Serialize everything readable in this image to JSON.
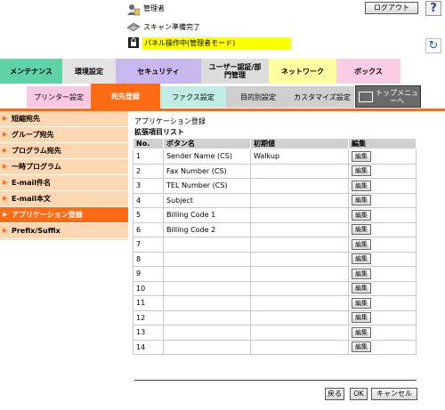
{
  "header": {
    "user_label": "管理者",
    "logout_label": "ログアウト",
    "help_glyph": "?",
    "scan_status": "スキャン準備完了",
    "panel_status": "パネル操作中(管理者モード)",
    "refresh_glyph": "↻"
  },
  "main_tabs": [
    {
      "label": "メンテナンス",
      "color": "#5fd3a8"
    },
    {
      "label": "環境設定",
      "color": "#e3e3e3"
    },
    {
      "label": "セキュリティ",
      "color": "#c9b7f0"
    },
    {
      "label": "ユーザー認証/部門管理",
      "color": "#dcdcdc"
    },
    {
      "label": "ネットワーク",
      "color": "#ffffa0"
    },
    {
      "label": "ボックス",
      "color": "#fbcde4"
    }
  ],
  "sub_tabs": [
    {
      "label": "プリンター設定",
      "color": "#fbc8e4"
    },
    {
      "label": "宛先登録",
      "color": "#ff6a13",
      "active": true
    },
    {
      "label": "ファクス設定",
      "color": "#c0ece6"
    },
    {
      "label": "目的別設定",
      "color": "#cfcfcf"
    },
    {
      "label": "カスタマイズ設定",
      "color": "#cfcfcf"
    }
  ],
  "top_menu_label": "トップメニューへ",
  "sidebar": {
    "items": [
      {
        "label": "短縮宛先"
      },
      {
        "label": "グループ宛先"
      },
      {
        "label": "プログラム宛先"
      },
      {
        "label": "一時プログラム"
      },
      {
        "label": "E-mail件名"
      },
      {
        "label": "E-mail本文"
      },
      {
        "label": "アプリケーション登録",
        "active": true
      },
      {
        "label": "Prefix/Suffix"
      }
    ]
  },
  "content": {
    "title": "アプリケーション登録",
    "subtitle": "拡張項目リスト",
    "columns": [
      "No.",
      "ボタン名",
      "初期値",
      "編集"
    ],
    "edit_label": "編集",
    "rows": [
      {
        "no": "1",
        "name": "Sender Name (CS)",
        "initial": "Walkup"
      },
      {
        "no": "2",
        "name": "Fax Number (CS)",
        "initial": ""
      },
      {
        "no": "3",
        "name": "TEL Number (CS)",
        "initial": ""
      },
      {
        "no": "4",
        "name": "Subject",
        "initial": ""
      },
      {
        "no": "5",
        "name": "Billing Code 1",
        "initial": ""
      },
      {
        "no": "6",
        "name": "Billing Code 2",
        "initial": ""
      },
      {
        "no": "7",
        "name": "",
        "initial": ""
      },
      {
        "no": "8",
        "name": "",
        "initial": ""
      },
      {
        "no": "9",
        "name": "",
        "initial": ""
      },
      {
        "no": "10",
        "name": "",
        "initial": ""
      },
      {
        "no": "11",
        "name": "",
        "initial": ""
      },
      {
        "no": "12",
        "name": "",
        "initial": ""
      },
      {
        "no": "13",
        "name": "",
        "initial": ""
      },
      {
        "no": "14",
        "name": "",
        "initial": ""
      }
    ]
  },
  "footer": {
    "back_label": "戻る",
    "ok_label": "OK",
    "cancel_label": "キャンセル"
  }
}
